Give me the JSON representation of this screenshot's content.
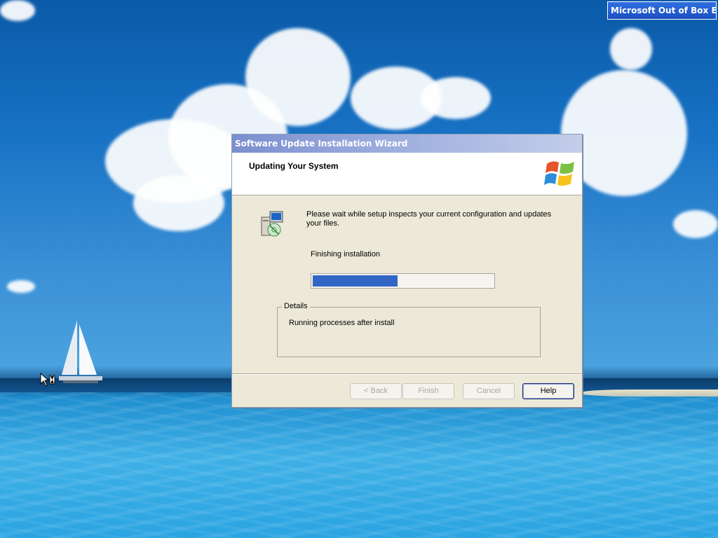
{
  "desktop": {
    "taskbar_window_title": "Microsoft Out of Box E..."
  },
  "wizard": {
    "title": "Software Update Installation Wizard",
    "header_title": "Updating Your System",
    "message": "Please wait while setup inspects your current configuration and updates your files.",
    "status": "Finishing installation",
    "progress_fraction": 0.47,
    "details_label": "Details",
    "details_text": "Running processes after install",
    "buttons": {
      "back": "< Back",
      "finish": "Finish",
      "cancel": "Cancel",
      "help": "Help"
    },
    "icons": {
      "logo": "windows-flag-icon",
      "setup": "setup-computer-icon"
    }
  },
  "colors": {
    "progress_fill": "#3166c4",
    "title_bar": "#7b8fcf",
    "dialog_bg": "#ece9d8"
  }
}
